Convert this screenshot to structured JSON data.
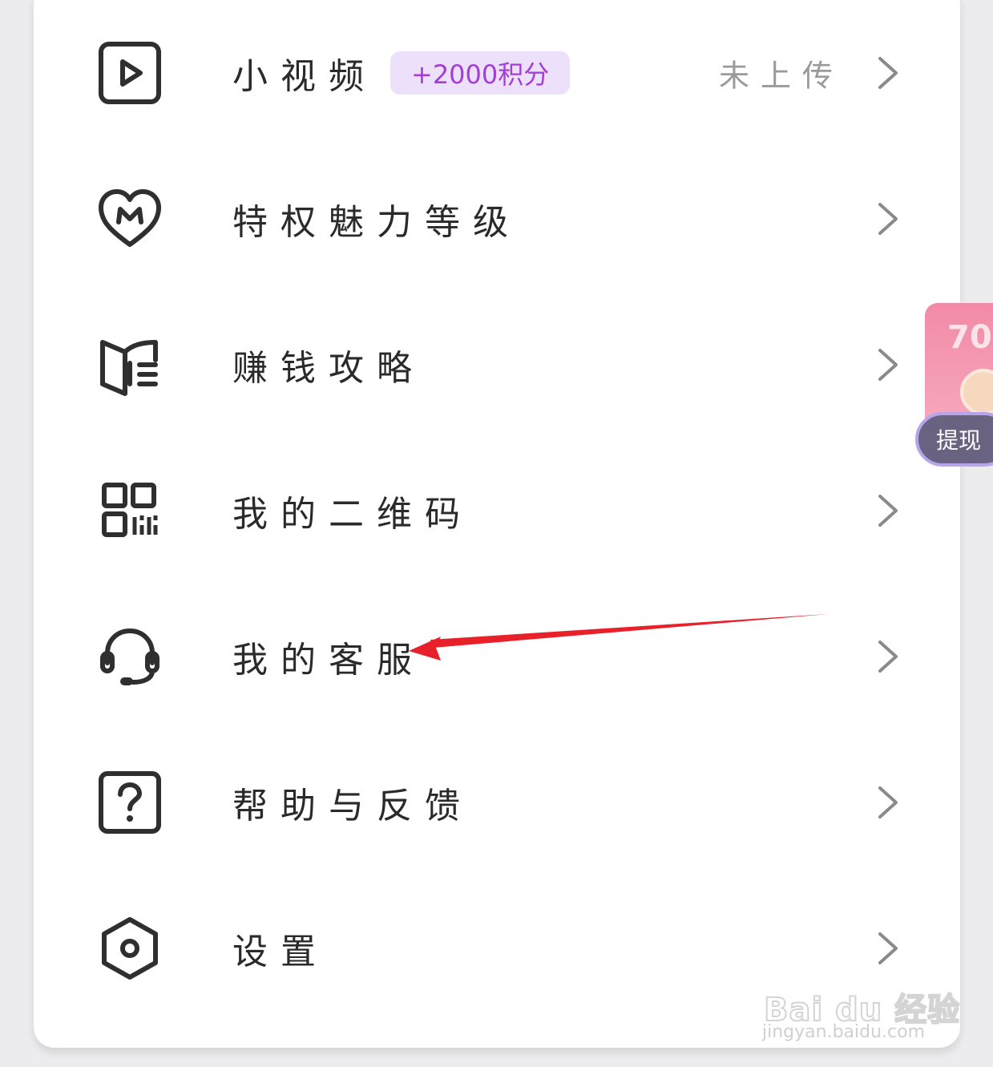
{
  "menu": {
    "items": [
      {
        "label": "小视频",
        "badge": "+2000积分",
        "status": "未上传",
        "icon": "play-video-icon"
      },
      {
        "label": "特权魅力等级",
        "icon": "heart-m-icon"
      },
      {
        "label": "赚钱攻略",
        "icon": "guide-book-icon"
      },
      {
        "label": "我的二维码",
        "icon": "qr-code-icon"
      },
      {
        "label": "我的客服",
        "icon": "headset-icon"
      },
      {
        "label": "帮助与反馈",
        "icon": "help-question-icon"
      },
      {
        "label": "设置",
        "icon": "settings-hexagon-icon"
      }
    ]
  },
  "promo": {
    "amount": "70",
    "button": "提现"
  },
  "annotation_arrow": {
    "color": "#e8202a",
    "points_to": "我的客服"
  },
  "watermark": {
    "brand": "Bai du 经验",
    "url": "jingyan.baidu.com"
  },
  "colors": {
    "badge_bg": "#ede0fb",
    "badge_text": "#a43fd6",
    "status_text": "#9a9a9a"
  }
}
